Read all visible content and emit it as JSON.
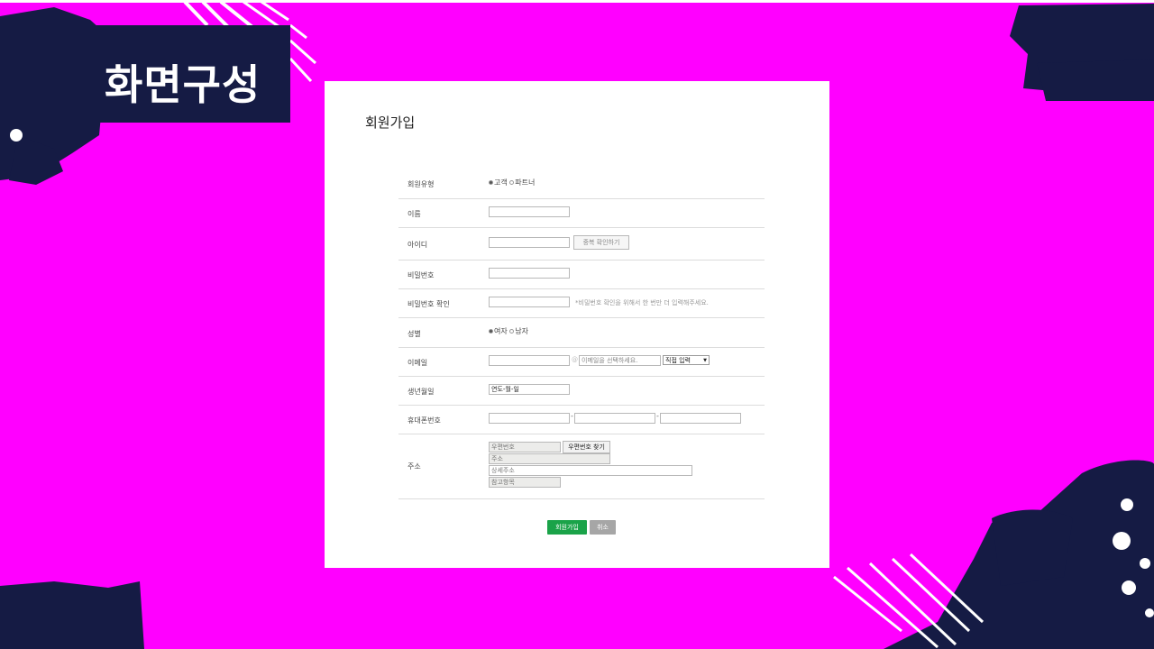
{
  "slide_title": "화면구성",
  "form": {
    "heading": "회원가입",
    "rows": {
      "member_type": {
        "label": "회원유형",
        "options": [
          "고객",
          "파트너"
        ]
      },
      "name": {
        "label": "이름"
      },
      "id": {
        "label": "아이디",
        "check_button": "중복 확인하기"
      },
      "password": {
        "label": "비밀번호"
      },
      "password_confirm": {
        "label": "비밀번호 확인",
        "hint": "*비밀번호 확인을 위해서 한 번만 더 입력해주세요."
      },
      "gender": {
        "label": "성별",
        "options": [
          "여자",
          "남자"
        ]
      },
      "email": {
        "label": "이메일",
        "at": "@",
        "domain_placeholder": "이메일을 선택하세요.",
        "select_value": "직접 입력"
      },
      "birth": {
        "label": "생년월일",
        "value": "연도-월-일"
      },
      "phone": {
        "label": "휴대폰번호",
        "sep": "-"
      },
      "address": {
        "label": "주소",
        "zip_placeholder": "우편번호",
        "find_button": "우편번호 찾기",
        "addr_placeholder": "주소",
        "detail_placeholder": "상세주소",
        "ref_placeholder": "참고항목"
      }
    },
    "submit_label": "회원가입",
    "cancel_label": "취소"
  },
  "colors": {
    "background": "#ff00ff",
    "navy": "#151b44",
    "submit": "#1aa349",
    "cancel": "#a6a6a6"
  }
}
